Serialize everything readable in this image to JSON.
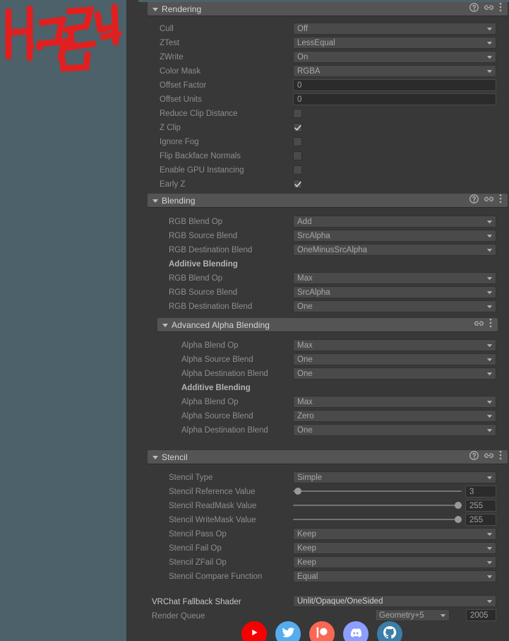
{
  "theme": {
    "left_background": "#4c6169",
    "inspector_background": "#383838",
    "header_background": "#545454",
    "field_background": "#4a4a4a",
    "textfield_background": "#2b2b2b",
    "label_color": "#8e8e8e",
    "graffiti_color": "#e02020"
  },
  "left_pane": {
    "graffiti_label": "red-marker-graffiti"
  },
  "sections": [
    {
      "id": "rendering",
      "title": "Rendering",
      "expanded": true,
      "has_help": true,
      "has_link": true,
      "has_menu": true,
      "rows": [
        {
          "label": "Cull",
          "type": "dropdown",
          "value": "Off"
        },
        {
          "label": "ZTest",
          "type": "dropdown",
          "value": "LessEqual"
        },
        {
          "label": "ZWrite",
          "type": "dropdown",
          "value": "On"
        },
        {
          "label": "Color Mask",
          "type": "dropdown",
          "value": "RGBA"
        },
        {
          "label": "Offset Factor",
          "type": "text",
          "value": "0"
        },
        {
          "label": "Offset Units",
          "type": "text",
          "value": "0"
        },
        {
          "label": "Reduce Clip Distance",
          "type": "checkbox",
          "value": false
        },
        {
          "label": "Z Clip",
          "type": "checkbox",
          "value": true
        },
        {
          "label": "Ignore Fog",
          "type": "checkbox",
          "value": false
        },
        {
          "label": "Flip Backface Normals",
          "type": "checkbox",
          "value": false
        },
        {
          "label": "Enable GPU Instancing",
          "type": "checkbox",
          "value": false
        },
        {
          "label": "Early Z",
          "type": "checkbox",
          "value": true
        }
      ]
    },
    {
      "id": "blending",
      "title": "Blending",
      "expanded": true,
      "has_help": true,
      "has_link": true,
      "has_menu": true,
      "rows": [
        {
          "label": "RGB Blend Op",
          "type": "dropdown",
          "value": "Add"
        },
        {
          "label": "RGB Source Blend",
          "type": "dropdown",
          "value": "SrcAlpha"
        },
        {
          "label": "RGB Destination Blend",
          "type": "dropdown",
          "value": "OneMinusSrcAlpha"
        },
        {
          "label": "Additive Blending",
          "type": "subheader"
        },
        {
          "label": "RGB Blend Op",
          "type": "dropdown",
          "value": "Max"
        },
        {
          "label": "RGB Source Blend",
          "type": "dropdown",
          "value": "SrcAlpha"
        },
        {
          "label": "RGB Destination Blend",
          "type": "dropdown",
          "value": "One"
        }
      ]
    },
    {
      "id": "advanced-alpha-blending",
      "title": "Advanced Alpha Blending",
      "expanded": true,
      "has_help": false,
      "has_link": true,
      "has_menu": true,
      "rows": [
        {
          "label": "Alpha Blend Op",
          "type": "dropdown",
          "value": "Max"
        },
        {
          "label": "Alpha Source Blend",
          "type": "dropdown",
          "value": "One"
        },
        {
          "label": "Alpha Destination Blend",
          "type": "dropdown",
          "value": "One"
        },
        {
          "label": "Additive Blending",
          "type": "subheader"
        },
        {
          "label": "Alpha Blend Op",
          "type": "dropdown",
          "value": "Max"
        },
        {
          "label": "Alpha Source Blend",
          "type": "dropdown",
          "value": "Zero"
        },
        {
          "label": "Alpha Destination Blend",
          "type": "dropdown",
          "value": "One"
        }
      ]
    },
    {
      "id": "stencil",
      "title": "Stencil",
      "expanded": true,
      "has_help": true,
      "has_link": true,
      "has_menu": true,
      "rows": [
        {
          "label": "Stencil Type",
          "type": "dropdown",
          "value": "Simple"
        },
        {
          "label": "Stencil Reference Value",
          "type": "slider",
          "value": "3",
          "fraction": 0.01
        },
        {
          "label": "Stencil ReadMask Value",
          "type": "slider",
          "value": "255",
          "fraction": 1.0
        },
        {
          "label": "Stencil WriteMask Value",
          "type": "slider",
          "value": "255",
          "fraction": 1.0
        },
        {
          "label": "Stencil Pass Op",
          "type": "dropdown",
          "value": "Keep"
        },
        {
          "label": "Stencil Fail Op",
          "type": "dropdown",
          "value": "Keep"
        },
        {
          "label": "Stencil ZFail Op",
          "type": "dropdown",
          "value": "Keep"
        },
        {
          "label": "Stencil Compare Function",
          "type": "dropdown",
          "value": "Equal"
        }
      ]
    }
  ],
  "footer": {
    "fallback_shader_label": "VRChat Fallback Shader",
    "fallback_shader_value": "Unlit/Opaque/OneSided",
    "render_queue_label": "Render Queue",
    "render_queue_preset": "Geometry+5",
    "render_queue_value": "2005"
  },
  "socials": [
    {
      "name": "youtube",
      "color": "#f70000",
      "label": "YouTube"
    },
    {
      "name": "twitter",
      "color": "#55acee",
      "label": "Twitter"
    },
    {
      "name": "patreon",
      "color": "#f96854",
      "label": "Patreon"
    },
    {
      "name": "discord",
      "color": "#8c9eff",
      "label": "Discord"
    },
    {
      "name": "github",
      "color": "#3b7ea8",
      "label": "GitHub"
    }
  ]
}
